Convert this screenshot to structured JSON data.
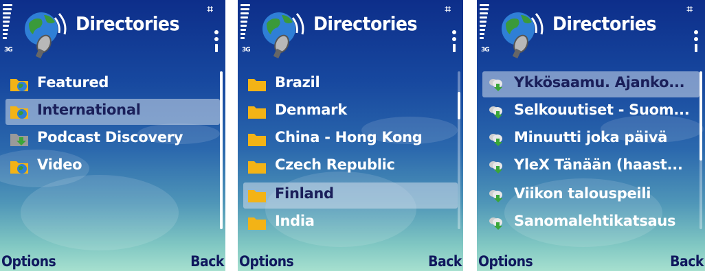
{
  "screens": [
    {
      "title": "Directories",
      "network": "3G",
      "softkey_left": "Options",
      "softkey_right": "Back",
      "items": [
        {
          "label": "Featured",
          "icon": "folder-globe-icon",
          "selected": false
        },
        {
          "label": "International",
          "icon": "folder-globe-icon",
          "selected": true
        },
        {
          "label": "Podcast Discovery",
          "icon": "folder-download-icon",
          "selected": false
        },
        {
          "label": "Video",
          "icon": "folder-globe-icon",
          "selected": false
        }
      ]
    },
    {
      "title": "Directories",
      "network": "3G",
      "softkey_left": "Options",
      "softkey_right": "Back",
      "items": [
        {
          "label": "Brazil",
          "icon": "folder-icon",
          "selected": false
        },
        {
          "label": "Denmark",
          "icon": "folder-icon",
          "selected": false
        },
        {
          "label": "China - Hong Kong",
          "icon": "folder-icon",
          "selected": false
        },
        {
          "label": "Czech Republic",
          "icon": "folder-icon",
          "selected": false
        },
        {
          "label": "Finland",
          "icon": "folder-icon",
          "selected": true
        },
        {
          "label": "India",
          "icon": "folder-icon",
          "selected": false
        }
      ]
    },
    {
      "title": "Directories",
      "network": "3G",
      "softkey_left": "Options",
      "softkey_right": "Back",
      "items": [
        {
          "label": "Ykkösaamu. Ajanko...",
          "icon": "podcast-download-icon",
          "selected": true
        },
        {
          "label": "Selkouutiset - Suom...",
          "icon": "podcast-download-icon",
          "selected": false
        },
        {
          "label": "Minuutti joka päivä",
          "icon": "podcast-download-icon",
          "selected": false
        },
        {
          "label": "YleX Tänään (haast...",
          "icon": "podcast-download-icon",
          "selected": false
        },
        {
          "label": "Viikon talouspeili",
          "icon": "podcast-download-icon",
          "selected": false
        },
        {
          "label": "Sanomalehtikatsaus",
          "icon": "podcast-download-icon",
          "selected": false
        }
      ]
    }
  ],
  "colors": {
    "folder": "#f3b316",
    "globe": "#2f7fd6",
    "land": "#3a9a3a",
    "selected_text": "#1a1f5a",
    "softkey": "#10185e"
  }
}
